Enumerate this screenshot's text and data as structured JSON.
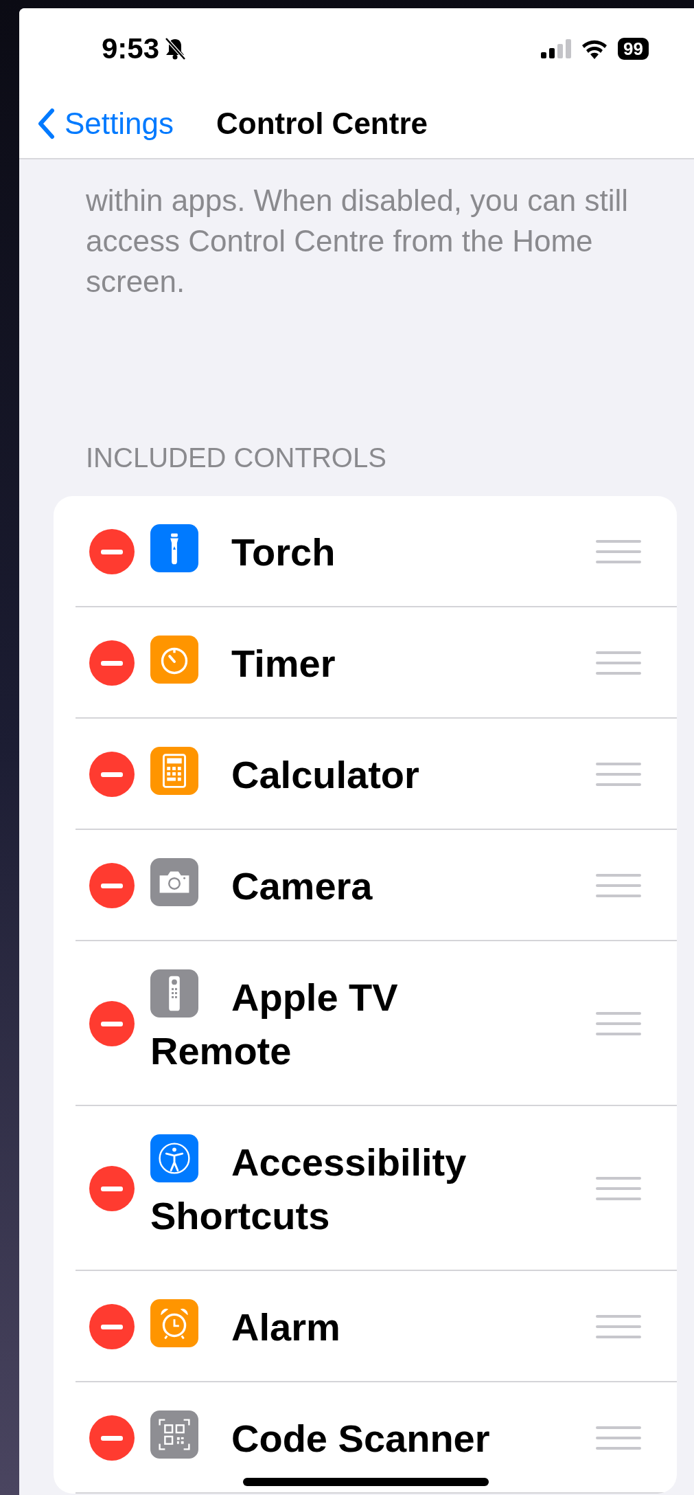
{
  "status_bar": {
    "time": "9:53",
    "battery": "99"
  },
  "nav": {
    "back": "Settings",
    "title": "Control Centre"
  },
  "description": "within apps. When disabled, you can still access Control Centre from the Home screen.",
  "section_header": "INCLUDED CONTROLS",
  "controls": [
    {
      "name": "Torch",
      "kind": "torch",
      "color": "#007aff"
    },
    {
      "name": "Timer",
      "kind": "timer",
      "color": "#ff9500"
    },
    {
      "name": "Calculator",
      "kind": "calculator",
      "color": "#ff9500"
    },
    {
      "name": "Camera",
      "kind": "camera",
      "color": "#8e8e93"
    },
    {
      "name": "Apple TV Remote",
      "kind": "remote",
      "color": "#8e8e93"
    },
    {
      "name": "Accessibility Shortcuts",
      "kind": "accessibility",
      "color": "#007aff"
    },
    {
      "name": "Alarm",
      "kind": "alarm",
      "color": "#ff9500"
    },
    {
      "name": "Code Scanner",
      "kind": "scanner",
      "color": "#8e8e93"
    }
  ]
}
